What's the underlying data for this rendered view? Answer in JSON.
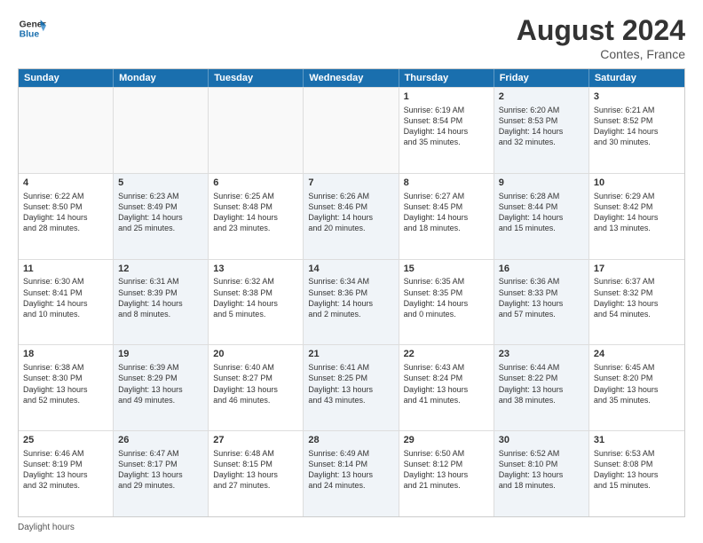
{
  "logo": {
    "line1": "General",
    "line2": "Blue"
  },
  "title": "August 2024",
  "location": "Contes, France",
  "header_days": [
    "Sunday",
    "Monday",
    "Tuesday",
    "Wednesday",
    "Thursday",
    "Friday",
    "Saturday"
  ],
  "legend_label": "Daylight hours",
  "rows": [
    [
      {
        "day": "",
        "info": "",
        "empty": true
      },
      {
        "day": "",
        "info": "",
        "empty": true
      },
      {
        "day": "",
        "info": "",
        "empty": true
      },
      {
        "day": "",
        "info": "",
        "empty": true
      },
      {
        "day": "1",
        "info": "Sunrise: 6:19 AM\nSunset: 8:54 PM\nDaylight: 14 hours\nand 35 minutes.",
        "shaded": false
      },
      {
        "day": "2",
        "info": "Sunrise: 6:20 AM\nSunset: 8:53 PM\nDaylight: 14 hours\nand 32 minutes.",
        "shaded": true
      },
      {
        "day": "3",
        "info": "Sunrise: 6:21 AM\nSunset: 8:52 PM\nDaylight: 14 hours\nand 30 minutes.",
        "shaded": false
      }
    ],
    [
      {
        "day": "4",
        "info": "Sunrise: 6:22 AM\nSunset: 8:50 PM\nDaylight: 14 hours\nand 28 minutes.",
        "shaded": false
      },
      {
        "day": "5",
        "info": "Sunrise: 6:23 AM\nSunset: 8:49 PM\nDaylight: 14 hours\nand 25 minutes.",
        "shaded": true
      },
      {
        "day": "6",
        "info": "Sunrise: 6:25 AM\nSunset: 8:48 PM\nDaylight: 14 hours\nand 23 minutes.",
        "shaded": false
      },
      {
        "day": "7",
        "info": "Sunrise: 6:26 AM\nSunset: 8:46 PM\nDaylight: 14 hours\nand 20 minutes.",
        "shaded": true
      },
      {
        "day": "8",
        "info": "Sunrise: 6:27 AM\nSunset: 8:45 PM\nDaylight: 14 hours\nand 18 minutes.",
        "shaded": false
      },
      {
        "day": "9",
        "info": "Sunrise: 6:28 AM\nSunset: 8:44 PM\nDaylight: 14 hours\nand 15 minutes.",
        "shaded": true
      },
      {
        "day": "10",
        "info": "Sunrise: 6:29 AM\nSunset: 8:42 PM\nDaylight: 14 hours\nand 13 minutes.",
        "shaded": false
      }
    ],
    [
      {
        "day": "11",
        "info": "Sunrise: 6:30 AM\nSunset: 8:41 PM\nDaylight: 14 hours\nand 10 minutes.",
        "shaded": false
      },
      {
        "day": "12",
        "info": "Sunrise: 6:31 AM\nSunset: 8:39 PM\nDaylight: 14 hours\nand 8 minutes.",
        "shaded": true
      },
      {
        "day": "13",
        "info": "Sunrise: 6:32 AM\nSunset: 8:38 PM\nDaylight: 14 hours\nand 5 minutes.",
        "shaded": false
      },
      {
        "day": "14",
        "info": "Sunrise: 6:34 AM\nSunset: 8:36 PM\nDaylight: 14 hours\nand 2 minutes.",
        "shaded": true
      },
      {
        "day": "15",
        "info": "Sunrise: 6:35 AM\nSunset: 8:35 PM\nDaylight: 14 hours\nand 0 minutes.",
        "shaded": false
      },
      {
        "day": "16",
        "info": "Sunrise: 6:36 AM\nSunset: 8:33 PM\nDaylight: 13 hours\nand 57 minutes.",
        "shaded": true
      },
      {
        "day": "17",
        "info": "Sunrise: 6:37 AM\nSunset: 8:32 PM\nDaylight: 13 hours\nand 54 minutes.",
        "shaded": false
      }
    ],
    [
      {
        "day": "18",
        "info": "Sunrise: 6:38 AM\nSunset: 8:30 PM\nDaylight: 13 hours\nand 52 minutes.",
        "shaded": false
      },
      {
        "day": "19",
        "info": "Sunrise: 6:39 AM\nSunset: 8:29 PM\nDaylight: 13 hours\nand 49 minutes.",
        "shaded": true
      },
      {
        "day": "20",
        "info": "Sunrise: 6:40 AM\nSunset: 8:27 PM\nDaylight: 13 hours\nand 46 minutes.",
        "shaded": false
      },
      {
        "day": "21",
        "info": "Sunrise: 6:41 AM\nSunset: 8:25 PM\nDaylight: 13 hours\nand 43 minutes.",
        "shaded": true
      },
      {
        "day": "22",
        "info": "Sunrise: 6:43 AM\nSunset: 8:24 PM\nDaylight: 13 hours\nand 41 minutes.",
        "shaded": false
      },
      {
        "day": "23",
        "info": "Sunrise: 6:44 AM\nSunset: 8:22 PM\nDaylight: 13 hours\nand 38 minutes.",
        "shaded": true
      },
      {
        "day": "24",
        "info": "Sunrise: 6:45 AM\nSunset: 8:20 PM\nDaylight: 13 hours\nand 35 minutes.",
        "shaded": false
      }
    ],
    [
      {
        "day": "25",
        "info": "Sunrise: 6:46 AM\nSunset: 8:19 PM\nDaylight: 13 hours\nand 32 minutes.",
        "shaded": false
      },
      {
        "day": "26",
        "info": "Sunrise: 6:47 AM\nSunset: 8:17 PM\nDaylight: 13 hours\nand 29 minutes.",
        "shaded": true
      },
      {
        "day": "27",
        "info": "Sunrise: 6:48 AM\nSunset: 8:15 PM\nDaylight: 13 hours\nand 27 minutes.",
        "shaded": false
      },
      {
        "day": "28",
        "info": "Sunrise: 6:49 AM\nSunset: 8:14 PM\nDaylight: 13 hours\nand 24 minutes.",
        "shaded": true
      },
      {
        "day": "29",
        "info": "Sunrise: 6:50 AM\nSunset: 8:12 PM\nDaylight: 13 hours\nand 21 minutes.",
        "shaded": false
      },
      {
        "day": "30",
        "info": "Sunrise: 6:52 AM\nSunset: 8:10 PM\nDaylight: 13 hours\nand 18 minutes.",
        "shaded": true
      },
      {
        "day": "31",
        "info": "Sunrise: 6:53 AM\nSunset: 8:08 PM\nDaylight: 13 hours\nand 15 minutes.",
        "shaded": false
      }
    ]
  ]
}
